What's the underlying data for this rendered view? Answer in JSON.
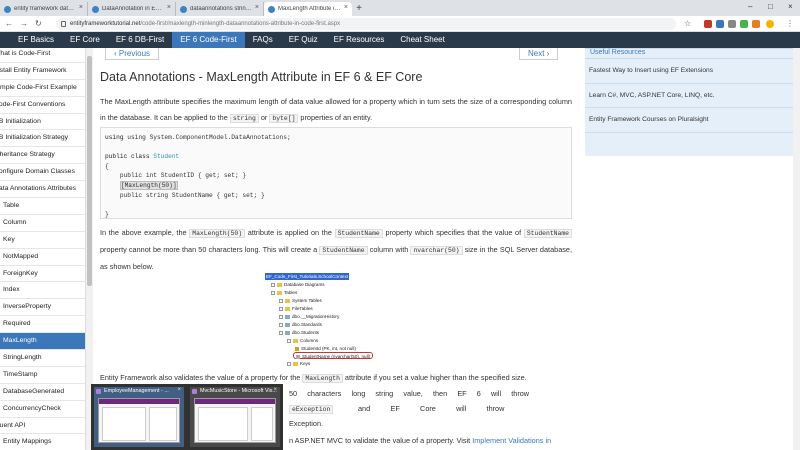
{
  "browser": {
    "tabs": [
      {
        "label": "entity framework data annotatio"
      },
      {
        "label": "DataAnnotation in EF 6 and EF C"
      },
      {
        "label": "dataannotations string max leng"
      },
      {
        "label": "MaxLength Attribute in EF 6 and",
        "active": true
      }
    ],
    "new_tab": "+",
    "url_domain": "entityframeworktutorial.net",
    "url_path": "/code-first/maxlength-minlength-dataannotations-attribute-in-code-first.aspx"
  },
  "site_nav": {
    "items": [
      "EF Basics",
      "EF Core",
      "EF 6 DB-First",
      "EF 6 Code-First",
      "FAQs",
      "EF Quiz",
      "EF Resources",
      "Cheat Sheet"
    ],
    "active": "EF 6 Code-First"
  },
  "sidebar": {
    "items": [
      {
        "label": "What is Code-First",
        "level": "top"
      },
      {
        "label": "Install Entity Framework",
        "level": "top"
      },
      {
        "label": "Simple Code-First Example",
        "level": "top"
      },
      {
        "label": "Code-First Conventions",
        "level": "top"
      },
      {
        "label": "DB Initialization",
        "level": "top"
      },
      {
        "label": "DB Initialization Strategy",
        "level": "top"
      },
      {
        "label": "Inheritance Strategy",
        "level": "top"
      },
      {
        "label": "Configure Domain Classes",
        "level": "top"
      },
      {
        "label": "Data Annotations Attributes",
        "level": "top"
      },
      {
        "label": "Table",
        "level": "child"
      },
      {
        "label": "Column",
        "level": "child"
      },
      {
        "label": "Key",
        "level": "child"
      },
      {
        "label": "NotMapped",
        "level": "child"
      },
      {
        "label": "ForeignKey",
        "level": "child"
      },
      {
        "label": "Index",
        "level": "child"
      },
      {
        "label": "InverseProperty",
        "level": "child"
      },
      {
        "label": "Required",
        "level": "child"
      },
      {
        "label": "MaxLength",
        "level": "child",
        "active": true
      },
      {
        "label": "StringLength",
        "level": "child"
      },
      {
        "label": "TimeStamp",
        "level": "child"
      },
      {
        "label": "DatabaseGenerated",
        "level": "child"
      },
      {
        "label": "ConcurrencyCheck",
        "level": "child"
      },
      {
        "label": "Fluent API",
        "level": "top"
      },
      {
        "label": "Entity Mappings",
        "level": "child"
      }
    ]
  },
  "main": {
    "prev_label": "‹ Previous",
    "next_label": "Next ›",
    "title": "Data Annotations - MaxLength Attribute in EF 6 & EF Core",
    "intro": {
      "text1": "The MaxLength attribute specifies the maximum length of data value allowed for a property which in turn sets the size of a corresponding column in the database. It can be applied to the ",
      "code1": "string",
      "text2": " or ",
      "code2": "byte[]",
      "text3": " properties of an entity."
    },
    "code_lines": [
      "using System.ComponentModel.DataAnnotations;",
      "",
      "public class Student",
      "{",
      "    public int StudentID { get; set; }",
      "    [MaxLength(50)]",
      "    public string StudentName { get; set; }",
      "",
      "}"
    ],
    "example": {
      "t1": "In the above example, the ",
      "c1": "MaxLength(50)",
      "t2": " attribute is applied on the ",
      "c2": "StudentName",
      "t3": " property which specifies that the value of ",
      "c3": "StudentName",
      "t4": " property cannot be more than 50 characters long. This will create a ",
      "c4": "StudentName",
      "t5": " column with ",
      "c5": "nvarchar(50)",
      "t6": " size in the SQL Server database, as shown below."
    },
    "tree_nodes": [
      "EF_Code_First_Tutorials.SchoolContext",
      "Database Diagrams",
      "Tables",
      "System Tables",
      "FileTables",
      "dbo.__MigrationHistory",
      "dbo.Standards",
      "dbo.Students",
      "Columns",
      "StudentId (PK, int, not null)",
      "StudentName (nvarchar(50), null)",
      "Keys"
    ],
    "validate": {
      "t1": "Entity Framework also validates the value of a property for the ",
      "c1": "MaxLength",
      "t2": " attribute if you set a value higher than the specified size.",
      "line2": "50     characters     long     string     value,     then     EF     6     will     throw",
      "c2": "eException",
      "line3": "and          EF          Core          will          throw",
      "line3b": "Exception."
    },
    "mvc": {
      "t1": "n ASP.NET MVC to validate the value of a property. Visit ",
      "link": "Implement Validations in"
    }
  },
  "right": {
    "heading": "Useful Resources",
    "links": [
      "Fastest Way to Insert using EF Extensions",
      "Learn C#, MVC, ASP.NET Core, LINQ, etc.",
      "Entity Framework Courses on Pluralsight"
    ]
  },
  "taskbar_thumbs": [
    {
      "title": "EmployeeManagement - ..."
    },
    {
      "title": "MvcMusicStore - Microsoft Vis..."
    }
  ],
  "colors": {
    "nav_bg": "#2b3a4a",
    "accent": "#3c78b9",
    "resources_bg": "#e5eff9"
  }
}
